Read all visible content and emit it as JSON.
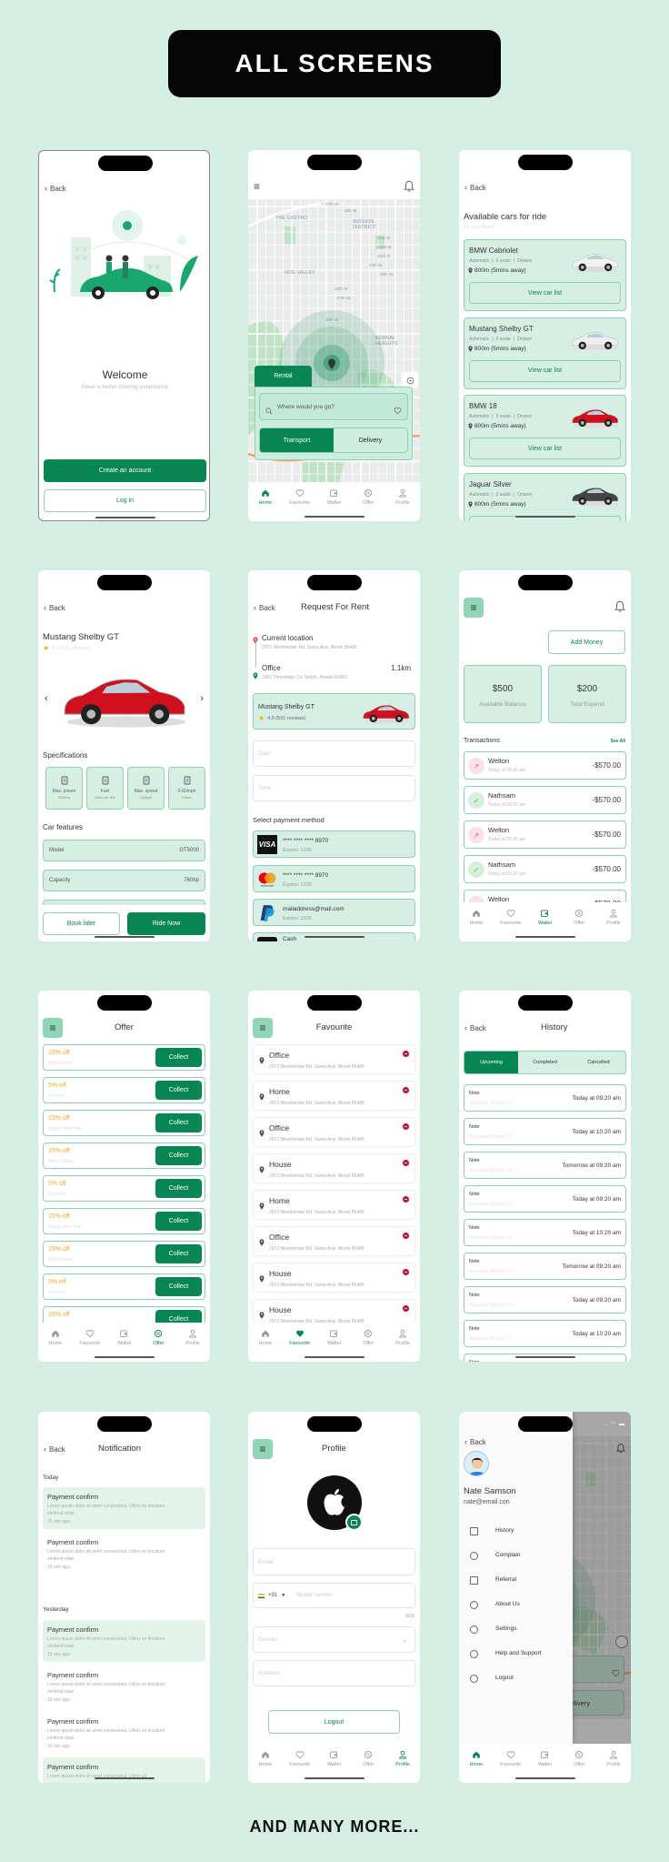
{
  "header": {
    "title": "ALL SCREENS"
  },
  "footer": {
    "text": "AND MANY MORE..."
  },
  "colors": {
    "background": "#d4eee3",
    "primary": "#078553",
    "light": "#d5efe4",
    "border": "#8fcfb2",
    "offer": "#f5a623",
    "remove": "#c2103e"
  },
  "nav": {
    "items": [
      {
        "label": "Home",
        "icon": "home-icon"
      },
      {
        "label": "Favourite",
        "icon": "heart-icon"
      },
      {
        "label": "Wallet",
        "icon": "wallet-icon"
      },
      {
        "label": "Offer",
        "icon": "offer-icon"
      },
      {
        "label": "Profile",
        "icon": "profile-icon"
      }
    ]
  },
  "common": {
    "back": "Back"
  },
  "welcome": {
    "title": "Welcome",
    "subtitle": "Have a better sharing experience",
    "create": "Create an account",
    "login": "Log in"
  },
  "home": {
    "map_labels": [
      "THE CASTRO",
      "MISSION DISTRICT",
      "NOE VALLEY",
      "BERNAL HEIGHTS",
      "17th St",
      "18th St",
      "21st St",
      "22nd St",
      "23rd St",
      "24th St",
      "25th St",
      "26th St",
      "27th St",
      "29th St"
    ],
    "rental": "Rental",
    "search_placeholder": "Where would you go?",
    "transport": "Transport",
    "delivery": "Delivery"
  },
  "cars": {
    "title": "Available cars for ride",
    "subtitle": "18 cars found",
    "items": [
      {
        "name": "BMW Cabriolet",
        "specs": [
          "Automatic",
          "3 seats",
          "Octane"
        ],
        "distance": "800m (5mins away)",
        "button": "View car list",
        "color": "#f2f2f2"
      },
      {
        "name": "Mustang Shelby GT",
        "specs": [
          "Automatic",
          "3 seats",
          "Octane"
        ],
        "distance": "800m (5mins away)",
        "button": "View car list",
        "color": "#eeeeee"
      },
      {
        "name": "BMW 18",
        "specs": [
          "Automatic",
          "3 seats",
          "Octane"
        ],
        "distance": "800m (5mins away)",
        "button": "View car list",
        "color": "#d0101c"
      },
      {
        "name": "Jaguar Silver",
        "specs": [
          "Automatic",
          "3 seats",
          "Octane"
        ],
        "distance": "800m (5mins away)",
        "button": "View car list",
        "color": "#444444"
      }
    ]
  },
  "detail": {
    "title": "Mustang Shelby GT",
    "rating": "4.9 (531 reviews)",
    "specs_heading": "Specifications",
    "specs": [
      {
        "label": "Max. power",
        "value": "2500hp",
        "icon": "battery-icon"
      },
      {
        "label": "Fuel",
        "value": "10km per litre",
        "icon": "fuel-icon"
      },
      {
        "label": "Max. speed",
        "value": "230kph",
        "icon": "speedometer-icon"
      },
      {
        "label": "0-60mph",
        "value": "2.5sec",
        "icon": "gearshift-icon"
      }
    ],
    "features_heading": "Car features",
    "features": [
      {
        "label": "Model",
        "value": "GT5000"
      },
      {
        "label": "Capacity",
        "value": "760hp"
      }
    ],
    "book_later": "Book later",
    "ride_now": "Ride Now"
  },
  "request": {
    "title": "Request For Rent",
    "from_label": "Current location",
    "from_address": "2972 Westheimer Rd. Santa Ana, Illinois 85486",
    "to_label": "Office",
    "to_address": "1901 Thornridge Cir. Shiloh, Hawaii 81063",
    "distance": "1.1km",
    "car_name": "Mustang Shelby GT",
    "car_rating": "4.9 (531 reviews)",
    "date_placeholder": "Date",
    "time_placeholder": "Time",
    "payment_heading": "Select payment method",
    "payments": [
      {
        "brand": "VISA",
        "number": "**** **** **** 8970",
        "expires": "Expires: 12/26"
      },
      {
        "brand": "mastercard",
        "number": "**** **** **** 8970",
        "expires": "Expires: 12/26"
      },
      {
        "brand": "PayPal",
        "number": "mailaddress@mail.com",
        "expires": "Expires: 12/26"
      }
    ],
    "cash": "Cash"
  },
  "wallet": {
    "add_money": "Add Money",
    "balances": [
      {
        "amount": "$500",
        "label": "Available Balance"
      },
      {
        "amount": "$200",
        "label": "Total Expend"
      }
    ],
    "transactions_heading": "Transactions",
    "see_all": "See All",
    "transactions": [
      {
        "name": "Welton",
        "time": "Today at 09:20 am",
        "amount": "-$570.00",
        "type": "sent"
      },
      {
        "name": "Nathsam",
        "time": "Today at 09:20 am",
        "amount": "-$570.00",
        "type": "received"
      },
      {
        "name": "Welton",
        "time": "Today at 09:20 am",
        "amount": "-$570.00",
        "type": "sent"
      },
      {
        "name": "Nathsam",
        "time": "Today at 09:20 am",
        "amount": "-$570.00",
        "type": "received"
      },
      {
        "name": "Welton",
        "amount": "-$570.00",
        "type": "sent"
      }
    ]
  },
  "offer": {
    "title": "Offer",
    "collect": "Collect",
    "items": [
      {
        "discount": "15% off",
        "name": "Black Friday"
      },
      {
        "discount": "5% off",
        "name": "Crismus"
      },
      {
        "discount": "15% off",
        "name": "Happy New Year"
      },
      {
        "discount": "15% off",
        "name": "Black Friday"
      },
      {
        "discount": "5% off",
        "name": "Crismus"
      },
      {
        "discount": "15% off",
        "name": "Happy New Year"
      },
      {
        "discount": "15% off",
        "name": "Black Friday"
      },
      {
        "discount": "5% off",
        "name": "Crismus"
      },
      {
        "discount": "15% off"
      }
    ]
  },
  "favourite": {
    "title": "Favourite",
    "items": [
      {
        "name": "Office",
        "address": "2972 Westheimer Rd. Santa Ana, Illinois 85486"
      },
      {
        "name": "Home",
        "address": "2972 Westheimer Rd. Santa Ana, Illinois 85486"
      },
      {
        "name": "Office",
        "address": "2972 Westheimer Rd. Santa Ana, Illinois 85486"
      },
      {
        "name": "House",
        "address": "2972 Westheimer Rd. Santa Ana, Illinois 85486"
      },
      {
        "name": "Home",
        "address": "2972 Westheimer Rd. Santa Ana, Illinois 85486"
      },
      {
        "name": "Office",
        "address": "2972 Westheimer Rd. Santa Ana, Illinois 85486"
      },
      {
        "name": "House",
        "address": "2972 Westheimer Rd. Santa Ana, Illinois 85486"
      },
      {
        "name": "House",
        "address": "2972 Westheimer Rd. Santa Ana, Illinois 85486"
      }
    ]
  },
  "history": {
    "title": "History",
    "tabs": [
      "Upcoming",
      "Completed",
      "Cancelled"
    ],
    "active_tab": "Upcoming",
    "items": [
      {
        "label": "Note",
        "car": "Mustang Shelby GT",
        "time": "Today at 09:20 am"
      },
      {
        "label": "Note",
        "car": "Mustang Shelby GT",
        "time": "Today at 10:20 am"
      },
      {
        "label": "Note",
        "car": "Mustang Shelby GT",
        "time": "Tomorrow at 09:20 am"
      },
      {
        "label": "Note",
        "car": "Mustang Shelby GT",
        "time": "Today at 09:20 am"
      },
      {
        "label": "Note",
        "car": "Mustang Shelby GT",
        "time": "Today at 10:20 am"
      },
      {
        "label": "Note",
        "car": "Mustang Shelby GT",
        "time": "Tomorrow at 09:20 am"
      },
      {
        "label": "Note",
        "car": "Mustang Shelby GT",
        "time": "Today at 09:20 am"
      },
      {
        "label": "Note",
        "car": "Mustang Shelby GT",
        "time": "Today at 10:20 am"
      },
      {
        "label": "Note"
      }
    ]
  },
  "notification": {
    "title": "Notification",
    "groups": [
      {
        "label": "Today",
        "items": [
          {
            "title": "Payment confirm",
            "body": "Lorem ipsum dolor sit amet consectetur. Ultrici es tincidunt eleifend vitae",
            "time": "15 min ago.",
            "highlight": true
          },
          {
            "title": "Payment confirm",
            "body": "Lorem ipsum dolor sit amet consectetur. Ultrici es tincidunt eleifend vitae",
            "time": "15 min ago.",
            "highlight": false
          }
        ]
      },
      {
        "label": "Yesterday",
        "items": [
          {
            "title": "Payment confirm",
            "body": "Lorem ipsum dolor sit amet consectetur. Ultrici es tincidunt eleifend vitae",
            "time": "15 min ago.",
            "highlight": true
          },
          {
            "title": "Payment confirm",
            "body": "Lorem ipsum dolor sit amet consectetur. Ultrici es tincidunt eleifend vitae",
            "time": "15 min ago.",
            "highlight": false
          },
          {
            "title": "Payment confirm",
            "body": "Lorem ipsum dolor sit amet consectetur. Ultrici es tincidunt eleifend vitae",
            "time": "15 min ago.",
            "highlight": false
          },
          {
            "title": "Payment confirm",
            "body": "Lorem ipsum dolor sit amet consectetur. Ultrici es",
            "highlight": true
          }
        ]
      }
    ]
  },
  "profile": {
    "title": "Profile",
    "email_placeholder": "Email",
    "country_code": "+91",
    "mobile_placeholder": "Mobile number",
    "mobile_counter": "0/10",
    "gender_placeholder": "Gender",
    "address_placeholder": "Address",
    "logout": "Logout"
  },
  "drawer": {
    "name": "Nate Samson",
    "email": "nate@email.con",
    "items": [
      {
        "label": "History",
        "icon": "history-icon"
      },
      {
        "label": "Complain",
        "icon": "complain-icon"
      },
      {
        "label": "Referral",
        "icon": "referral-icon"
      },
      {
        "label": "About Us",
        "icon": "info-icon"
      },
      {
        "label": "Settings",
        "icon": "settings-icon"
      },
      {
        "label": "Help and Support",
        "icon": "help-icon"
      },
      {
        "label": "Logout",
        "icon": "logout-icon"
      }
    ]
  }
}
